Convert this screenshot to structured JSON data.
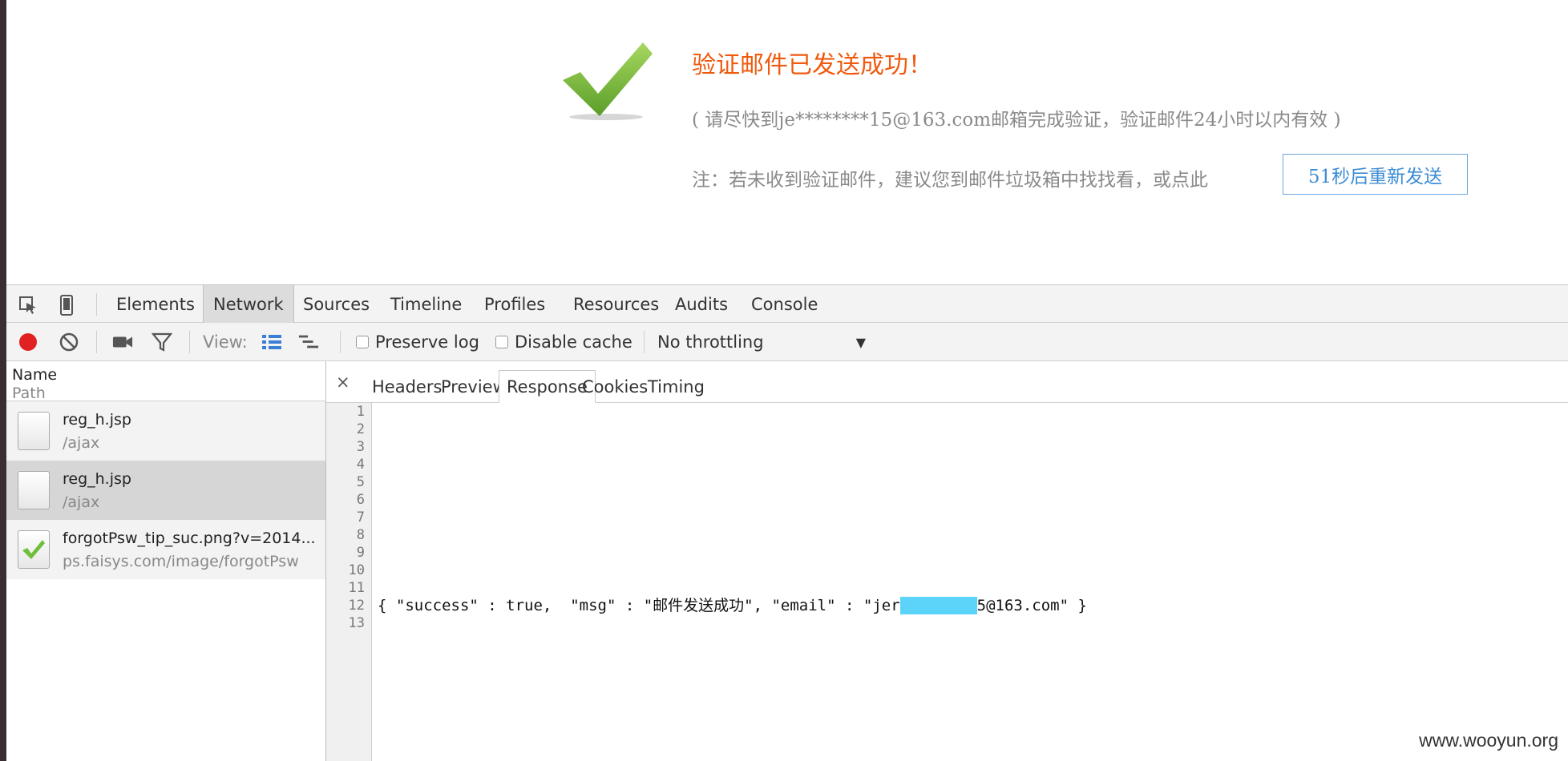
{
  "page": {
    "title": "验证邮件已发送成功！",
    "subtitle": "( 请尽快到je********15@163.com邮箱完成验证，验证邮件24小时以内有效 )",
    "note": "注：若未收到验证邮件，建议您到邮件垃圾箱中找找看，或点此",
    "resend_button": "51秒后重新发送"
  },
  "devtools": {
    "tabs": [
      "Elements",
      "Network",
      "Sources",
      "Timeline",
      "Profiles",
      "Resources",
      "Audits",
      "Console"
    ],
    "active_tab": "Network",
    "toolbar": {
      "view_label": "View:",
      "preserve_log": "Preserve log",
      "disable_cache": "Disable cache",
      "throttling": "No throttling"
    },
    "request_list": {
      "header_name": "Name",
      "header_path": "Path",
      "items": [
        {
          "name": "reg_h.jsp",
          "path": "/ajax"
        },
        {
          "name": "reg_h.jsp",
          "path": "/ajax"
        },
        {
          "name": "forgotPsw_tip_suc.png?v=2014...",
          "path": "ps.faisys.com/image/forgotPsw"
        }
      ],
      "selected_index": 1
    },
    "detail_tabs": [
      "Headers",
      "Preview",
      "Response",
      "Cookies",
      "Timing"
    ],
    "active_detail_tab": "Response",
    "close_glyph": "×",
    "response": {
      "line_numbers": [
        "1",
        "2",
        "3",
        "4",
        "5",
        "6",
        "7",
        "8",
        "9",
        "10",
        "11",
        "12",
        "13"
      ],
      "code_prefix": "{ \"success\" : true,  \"msg\" : \"邮件发送成功\", \"email\" : \"jer",
      "code_suffix": "5@163.com\" }"
    }
  },
  "watermark": "www.wooyun.org",
  "colors": {
    "title": "#f05a0f",
    "resend_border": "#6aa7dd",
    "record": "#e22222",
    "redaction": "#5cd3f8",
    "checkmark": "#7cc243"
  }
}
